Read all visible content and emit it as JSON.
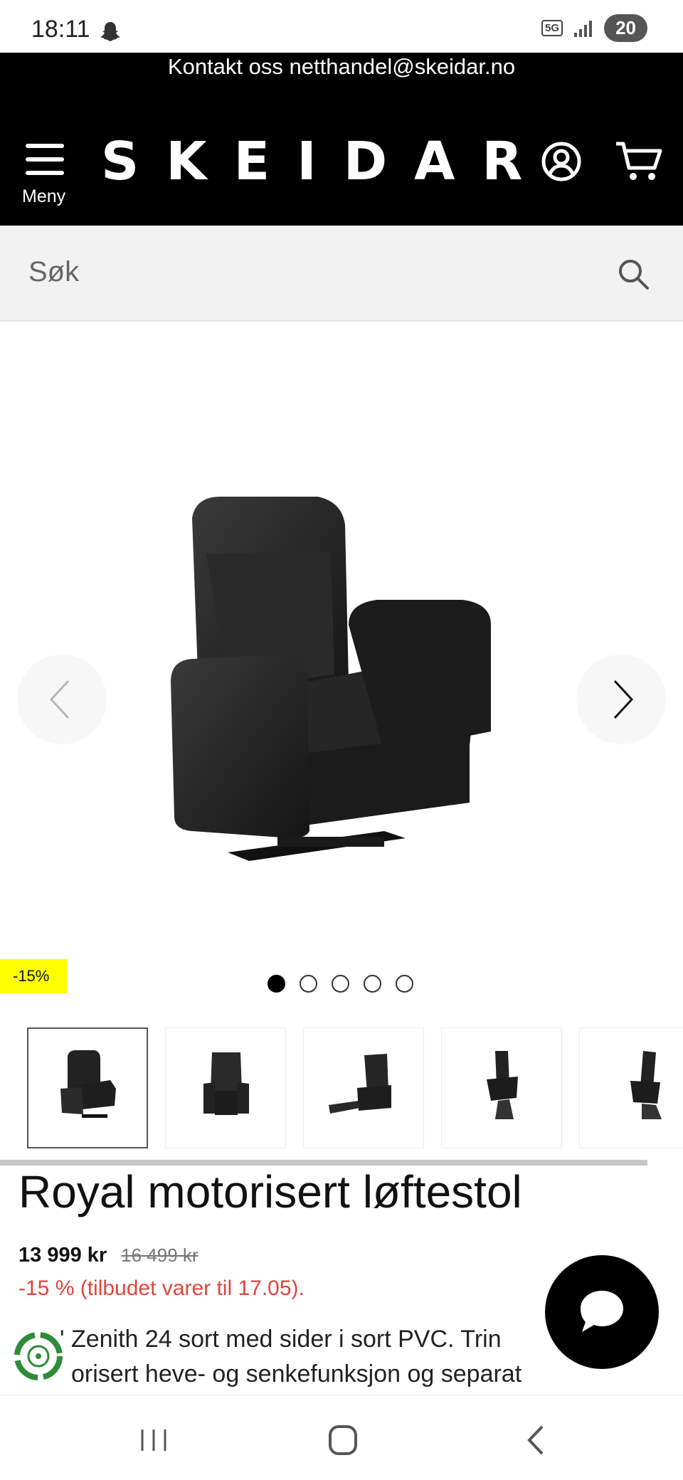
{
  "status_bar": {
    "time": "18:11",
    "network": "5G",
    "battery": "20"
  },
  "contact_bar": {
    "text": "Kontakt oss netthandel@skeidar.no"
  },
  "header": {
    "logo": "SKEIDAR",
    "menu_label": "Meny",
    "user_icon": "user-circle-icon",
    "cart_icon": "cart-icon"
  },
  "search": {
    "placeholder": "Søk"
  },
  "gallery": {
    "discount_badge": "-15%",
    "dots_count": 5,
    "active_dot": 0,
    "thumbnail_count": 5
  },
  "product": {
    "title": "Royal motorisert løftestol",
    "price": "13 999 kr",
    "old_price": "16 499 kr",
    "discount_text": "-15 % (tilbudet varer til 17.05).",
    "description_line1": "' Zenith 24 sort med sider i sort PVC. Trin",
    "description_line2": "orisert heve- og senkefunksjon og separat"
  },
  "colors": {
    "header_bg": "#000000",
    "badge_bg": "#ffff00",
    "discount_red": "#e0443c",
    "search_bg": "#f2f2f2"
  }
}
